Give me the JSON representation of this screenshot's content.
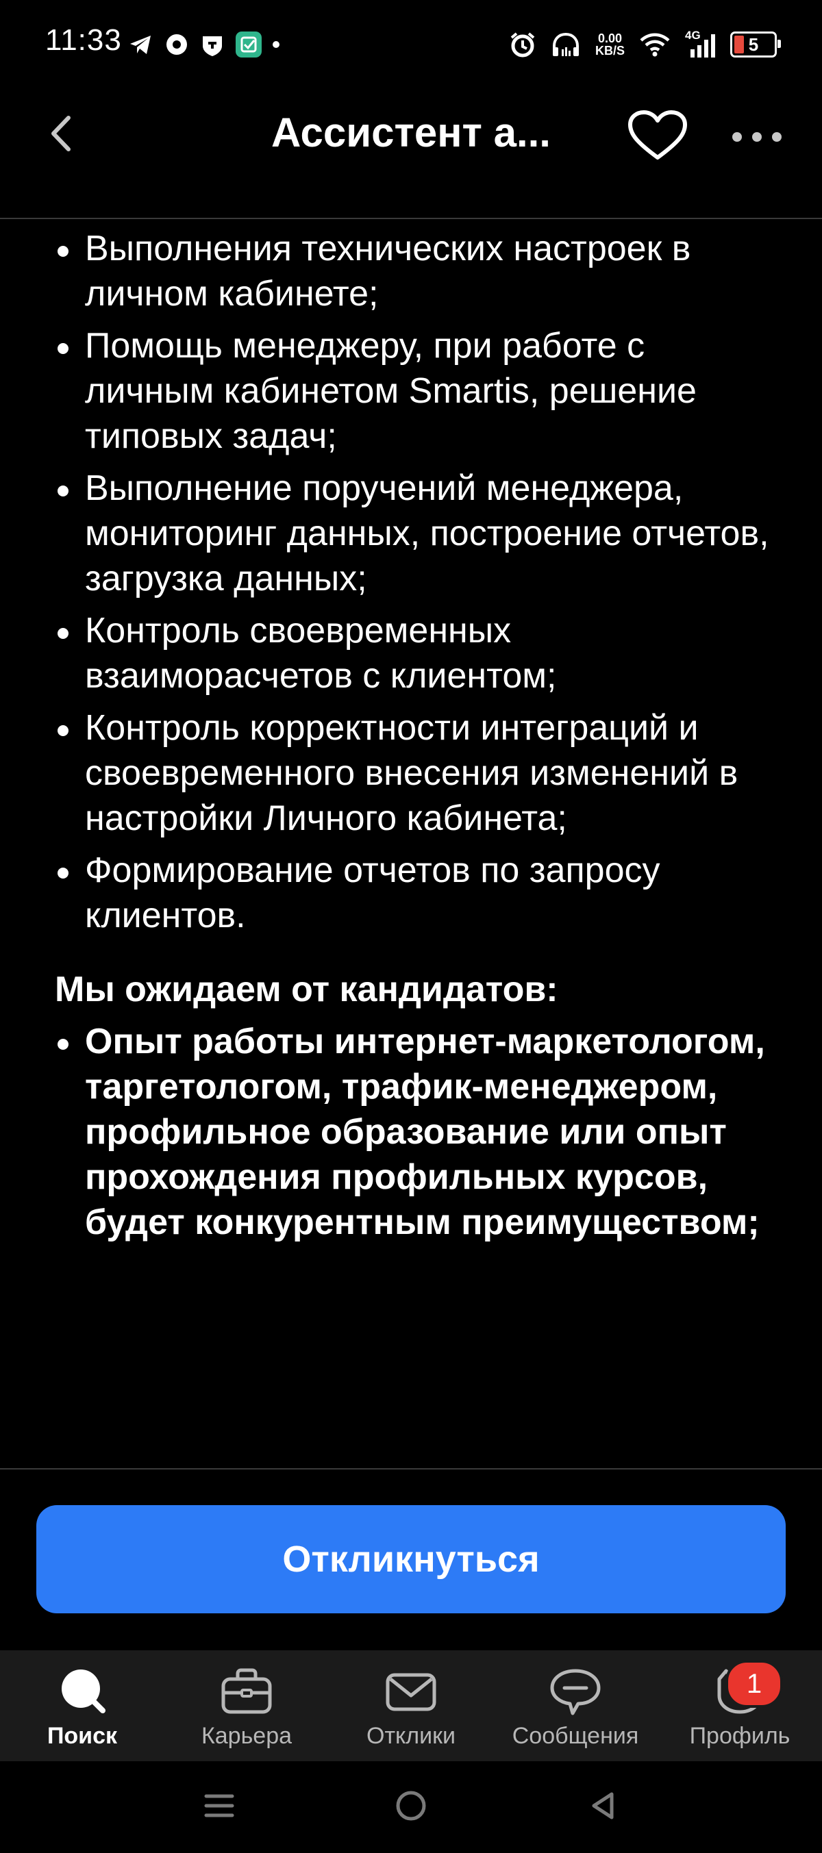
{
  "status_bar": {
    "time": "11:33",
    "speed_value": "0.00",
    "speed_unit": "KB/S",
    "network": "4G",
    "battery": "5"
  },
  "header": {
    "title": "Ассистент а..."
  },
  "duties": [
    "Выполнения технических настроек в личном кабинете;",
    "Помощь менеджеру, при работе с личным кабинетом Smartis, решение типовых задач;",
    "Выполнение поручений менеджера, мониторинг данных, построение отчетов, загрузка данных;",
    "Контроль своевременных взаиморасчетов с клиентом;",
    "Контроль корректности интеграций и своевременного внесения изменений в настройки Личного кабинета;",
    "Формирование отчетов по запросу клиентов."
  ],
  "expectations": {
    "title": "Мы ожидаем от кандидатов:",
    "items": [
      "Опыт работы интернет-маркетологом, таргетологом, трафик-менеджером, профильное образование или опыт прохождения профильных курсов, будет конкурентным преимуществом;"
    ]
  },
  "action": {
    "respond_label": "Откликнуться"
  },
  "tabs": [
    {
      "label": "Поиск",
      "icon": "search-icon",
      "active": true
    },
    {
      "label": "Карьера",
      "icon": "briefcase-icon",
      "active": false
    },
    {
      "label": "Отклики",
      "icon": "envelope-icon",
      "active": false
    },
    {
      "label": "Сообщения",
      "icon": "chat-icon",
      "active": false
    },
    {
      "label": "Профиль",
      "icon": "profile-icon",
      "active": false,
      "badge": "1"
    }
  ],
  "colors": {
    "background": "#000000",
    "primary_button": "#2d7bf6",
    "badge": "#e9352d",
    "tab_bar": "#1b1b1b"
  }
}
